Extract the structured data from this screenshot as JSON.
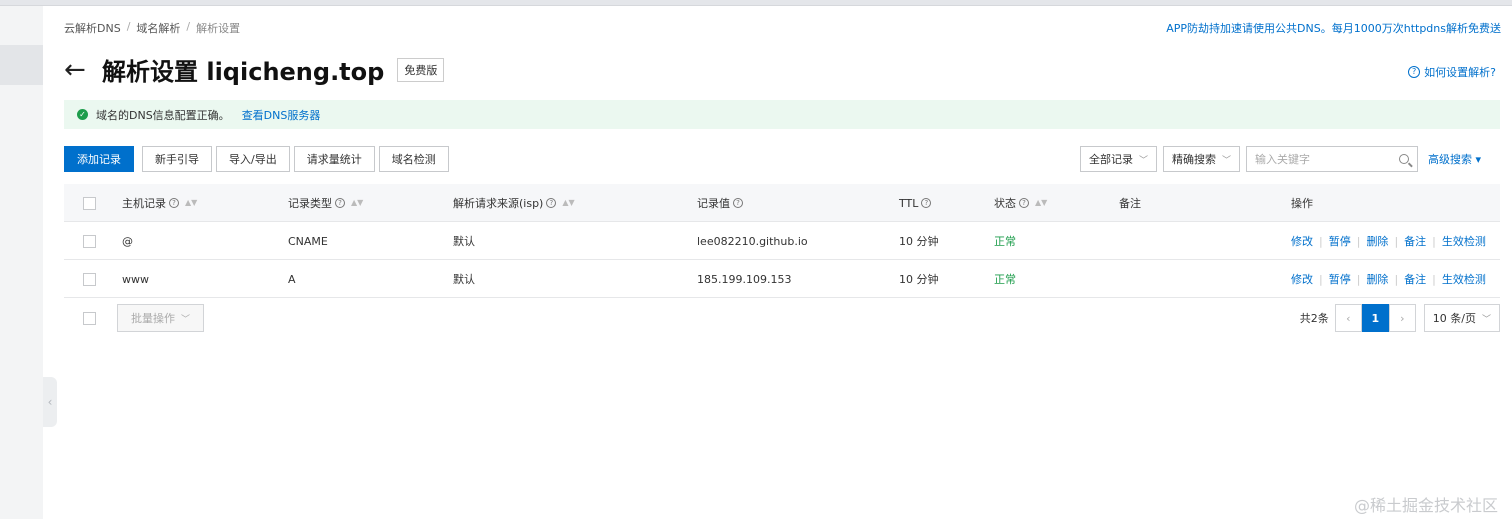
{
  "breadcrumb": {
    "items": [
      "云解析DNS",
      "域名解析",
      "解析设置"
    ],
    "separator": "/"
  },
  "promo_text": "APP防劫持加速请使用公共DNS。每月1000万次httpdns解析免费送",
  "header": {
    "back_icon": "←",
    "title": "解析设置 liqicheng.top",
    "badge": "免费版"
  },
  "help_link": "如何设置解析?",
  "notice": {
    "message": "域名的DNS信息配置正确。",
    "link": "查看DNS服务器"
  },
  "toolbar": {
    "add": "添加记录",
    "guide": "新手引导",
    "import_export": "导入/导出",
    "stats": "请求量统计",
    "check": "域名检测"
  },
  "filters": {
    "records": "全部记录",
    "search_mode": "精确搜索",
    "search_placeholder": "输入关键字",
    "advanced": "高级搜索"
  },
  "table": {
    "headers": {
      "host": "主机记录",
      "type": "记录类型",
      "isp": "解析请求来源(isp)",
      "value": "记录值",
      "ttl": "TTL",
      "status": "状态",
      "remark": "备注",
      "actions": "操作"
    },
    "rows": [
      {
        "host": "@",
        "type": "CNAME",
        "isp": "默认",
        "value": "lee082210.github.io",
        "ttl": "10 分钟",
        "status": "正常",
        "remark": ""
      },
      {
        "host": "www",
        "type": "A",
        "isp": "默认",
        "value": "185.199.109.153",
        "ttl": "10 分钟",
        "status": "正常",
        "remark": ""
      }
    ],
    "row_actions": [
      "修改",
      "暂停",
      "删除",
      "备注",
      "生效检测"
    ]
  },
  "batch_button": "批量操作",
  "pager": {
    "total": "共2条",
    "current_page": "1",
    "page_size": "10 条/页"
  },
  "watermark": "@稀土掘金技术社区",
  "colors": {
    "primary": "#0070cc",
    "success": "#1e9d4c",
    "notice_bg": "#ebf8f0"
  }
}
